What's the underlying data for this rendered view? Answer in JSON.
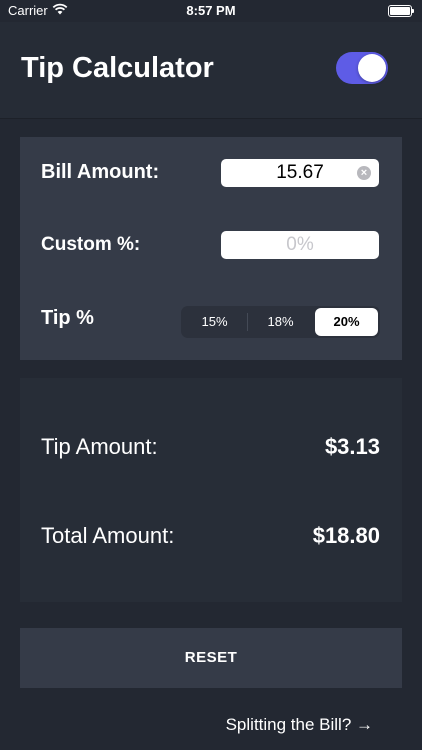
{
  "status_bar": {
    "carrier": "Carrier",
    "time": "8:57 PM"
  },
  "header": {
    "title": "Tip Calculator",
    "dark_mode_toggle_on": true,
    "toggle_color": "#5e5ce6"
  },
  "inputs": {
    "bill_label": "Bill Amount:",
    "bill_value": "15.67",
    "custom_label": "Custom %:",
    "custom_placeholder": "0%",
    "tip_label": "Tip %",
    "tip_options": [
      "15%",
      "18%",
      "20%"
    ],
    "selected_tip": "20%"
  },
  "results": {
    "tip_label": "Tip Amount:",
    "tip_value": "$3.13",
    "total_label": "Total Amount:",
    "total_value": "$18.80"
  },
  "actions": {
    "reset_label": "RESET",
    "split_label": "Splitting the Bill? →"
  }
}
